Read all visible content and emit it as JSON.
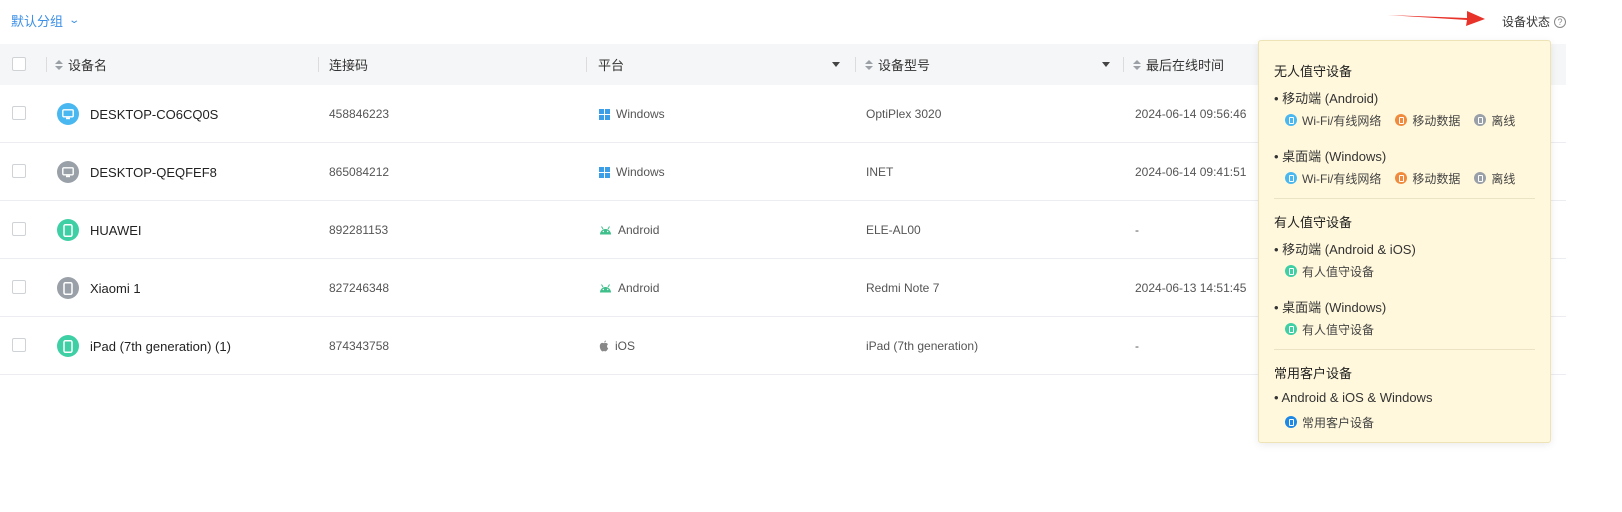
{
  "topbar": {
    "group_label": "默认分组",
    "status_label": "设备状态",
    "help_glyph": "?"
  },
  "table": {
    "columns": {
      "name": "设备名",
      "code": "连接码",
      "platform": "平台",
      "model": "设备型号",
      "last_online": "最后在线时间"
    },
    "rows": [
      {
        "name": "DESKTOP-CO6CQ0S",
        "code": "458846223",
        "platform": "Windows",
        "platform_icon": "windows-icon",
        "model": "OptiPlex 3020",
        "last_online": "2024-06-14 09:56:46",
        "icon": "desktop-icon",
        "color": "#4ab8f0"
      },
      {
        "name": "DESKTOP-QEQFEF8",
        "code": "865084212",
        "platform": "Windows",
        "platform_icon": "windows-icon",
        "model": "INET",
        "last_online": "2024-06-14 09:41:51",
        "icon": "desktop-icon",
        "color": "#9aa0a8"
      },
      {
        "name": "HUAWEI",
        "code": "892281153",
        "platform": "Android",
        "platform_icon": "android-icon",
        "model": "ELE-AL00",
        "last_online": "-",
        "icon": "phone-icon",
        "color": "#3fcfa4"
      },
      {
        "name": "Xiaomi 1",
        "code": "827246348",
        "platform": "Android",
        "platform_icon": "android-icon",
        "model": "Redmi Note 7",
        "last_online": "2024-06-13 14:51:45",
        "icon": "phone-icon",
        "color": "#9aa0a8"
      },
      {
        "name": "iPad (7th generation) (1)",
        "code": "874343758",
        "platform": "iOS",
        "platform_icon": "apple-icon",
        "model": "iPad (7th generation)",
        "last_online": "-",
        "icon": "phone-icon",
        "color": "#3fcfa4"
      }
    ]
  },
  "popover": {
    "sections": [
      {
        "title": "无人值守设备",
        "groups": [
          {
            "sub": "• 移动端 (Android)",
            "legend": [
              {
                "label": "Wi-Fi/有线网络",
                "color": "#4ab8f0"
              },
              {
                "label": "移动数据",
                "color": "#f08a3c"
              },
              {
                "label": "离线",
                "color": "#9aa0a8"
              }
            ]
          },
          {
            "sub": "• 桌面端 (Windows)",
            "legend": [
              {
                "label": "Wi-Fi/有线网络",
                "color": "#4ab8f0"
              },
              {
                "label": "移动数据",
                "color": "#f08a3c"
              },
              {
                "label": "离线",
                "color": "#9aa0a8"
              }
            ]
          }
        ]
      },
      {
        "title": "有人值守设备",
        "groups": [
          {
            "sub": "• 移动端 (Android & iOS)",
            "legend": [
              {
                "label": "有人值守设备",
                "color": "#3fcfa4"
              }
            ]
          },
          {
            "sub": "• 桌面端 (Windows)",
            "legend": [
              {
                "label": "有人值守设备",
                "color": "#3fcfa4"
              }
            ]
          }
        ]
      },
      {
        "title": "常用客户设备",
        "groups": [
          {
            "sub": "• Android & iOS & Windows",
            "legend": [
              {
                "label": "常用客户设备",
                "color": "#1e88e5"
              }
            ]
          }
        ]
      }
    ]
  }
}
